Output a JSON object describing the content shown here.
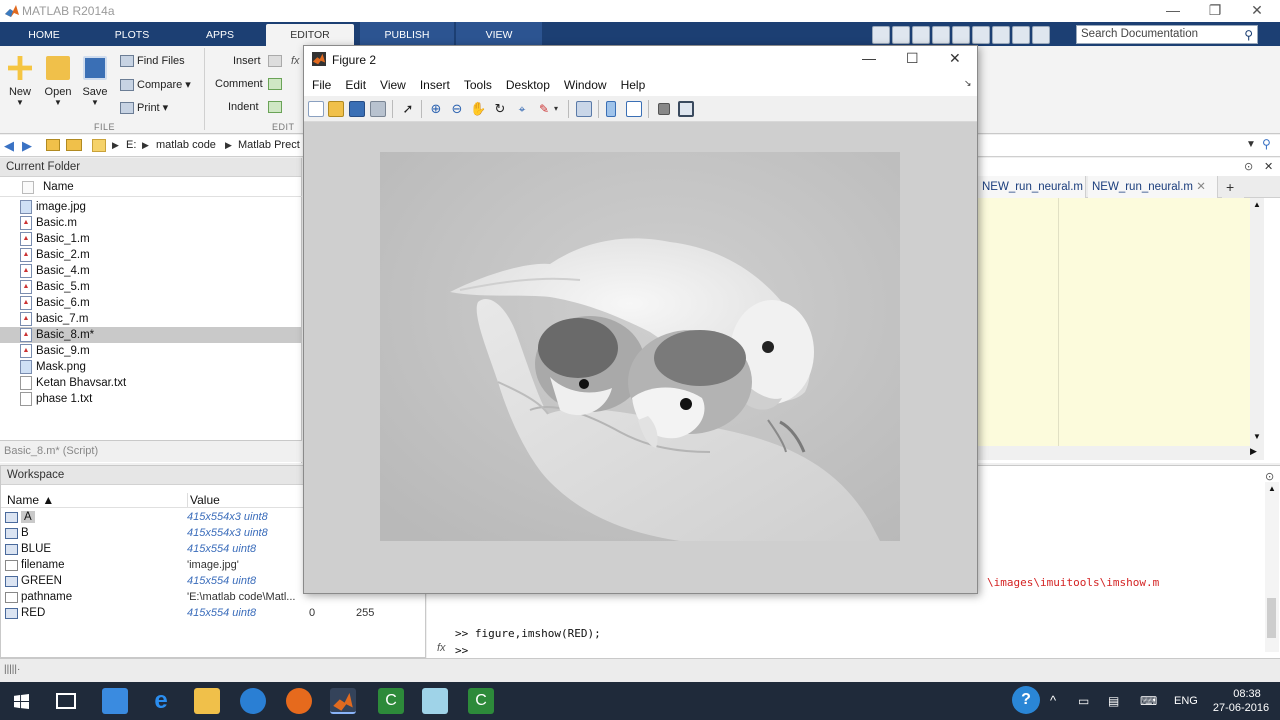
{
  "app": {
    "title": "MATLAB R2014a",
    "window_controls": [
      "—",
      "❐",
      "✕"
    ]
  },
  "ribbon": {
    "tabs": [
      "HOME",
      "PLOTS",
      "APPS",
      "EDITOR",
      "PUBLISH",
      "VIEW"
    ],
    "active_tab": "EDITOR",
    "search_placeholder": "Search Documentation",
    "file_group": {
      "new": "New",
      "open": "Open",
      "save": "Save",
      "find_files": "Find Files",
      "compare": "Compare",
      "print": "Print",
      "label": "FILE"
    },
    "edit_group": {
      "insert": "Insert",
      "comment": "Comment",
      "indent": "Indent",
      "fx": "fx",
      "label": "EDIT"
    }
  },
  "address_bar": {
    "path": [
      "E:",
      "matlab code",
      "Matlab Prect"
    ]
  },
  "current_folder": {
    "title": "Current Folder",
    "column": "Name",
    "files": [
      {
        "name": "image.jpg",
        "icon": "image-icon"
      },
      {
        "name": "Basic.m",
        "icon": "mfile-icon"
      },
      {
        "name": "Basic_1.m",
        "icon": "mfile-icon"
      },
      {
        "name": "Basic_2.m",
        "icon": "mfile-icon"
      },
      {
        "name": "Basic_4.m",
        "icon": "mfile-icon"
      },
      {
        "name": "Basic_5.m",
        "icon": "mfile-icon"
      },
      {
        "name": "Basic_6.m",
        "icon": "mfile-icon"
      },
      {
        "name": "basic_7.m",
        "icon": "mfile-icon"
      },
      {
        "name": "Basic_8.m*",
        "icon": "mfile-icon",
        "selected": true
      },
      {
        "name": "Basic_9.m",
        "icon": "mfile-icon"
      },
      {
        "name": "Mask.png",
        "icon": "image-icon"
      },
      {
        "name": "Ketan Bhavsar.txt",
        "icon": "text-icon"
      },
      {
        "name": "phase 1.txt",
        "icon": "text-icon"
      }
    ],
    "details": "Basic_8.m* (Script)"
  },
  "workspace": {
    "title": "Workspace",
    "columns": [
      "Name ▲",
      "Value"
    ],
    "variables": [
      {
        "name": "A",
        "value": "415x554x3 uint8",
        "min": "",
        "max": ""
      },
      {
        "name": "B",
        "value": "415x554x3 uint8",
        "min": "",
        "max": ""
      },
      {
        "name": "BLUE",
        "value": "415x554 uint8",
        "min": "",
        "max": ""
      },
      {
        "name": "filename",
        "value": "'image.jpg'",
        "min": "",
        "max": ""
      },
      {
        "name": "GREEN",
        "value": "415x554 uint8",
        "min": "",
        "max": ""
      },
      {
        "name": "pathname",
        "value": "'E:\\matlab code\\Matl...",
        "min": "",
        "max": ""
      },
      {
        "name": "RED",
        "value": "415x554 uint8",
        "min": "0",
        "max": "255"
      }
    ]
  },
  "editor": {
    "tabs": [
      "NEW_run_neural.m",
      "NEW_run_neural.m"
    ],
    "add_tab": "+"
  },
  "command_window": {
    "error_path": "\\images\\imuitools\\imshow.m",
    "prompt_cmd": ">> figure,imshow(RED);",
    "prompt": ">>",
    "fx": "fx"
  },
  "figure": {
    "title": "Figure 2",
    "controls": [
      "—",
      "☐",
      "✕"
    ],
    "menus": [
      "File",
      "Edit",
      "View",
      "Insert",
      "Tools",
      "Desktop",
      "Window",
      "Help"
    ],
    "image_desc": "grayscale photo of lovebirds on a hand"
  },
  "taskbar": {
    "lang": "ENG",
    "time": "08:38",
    "date": "27-06-2016"
  }
}
